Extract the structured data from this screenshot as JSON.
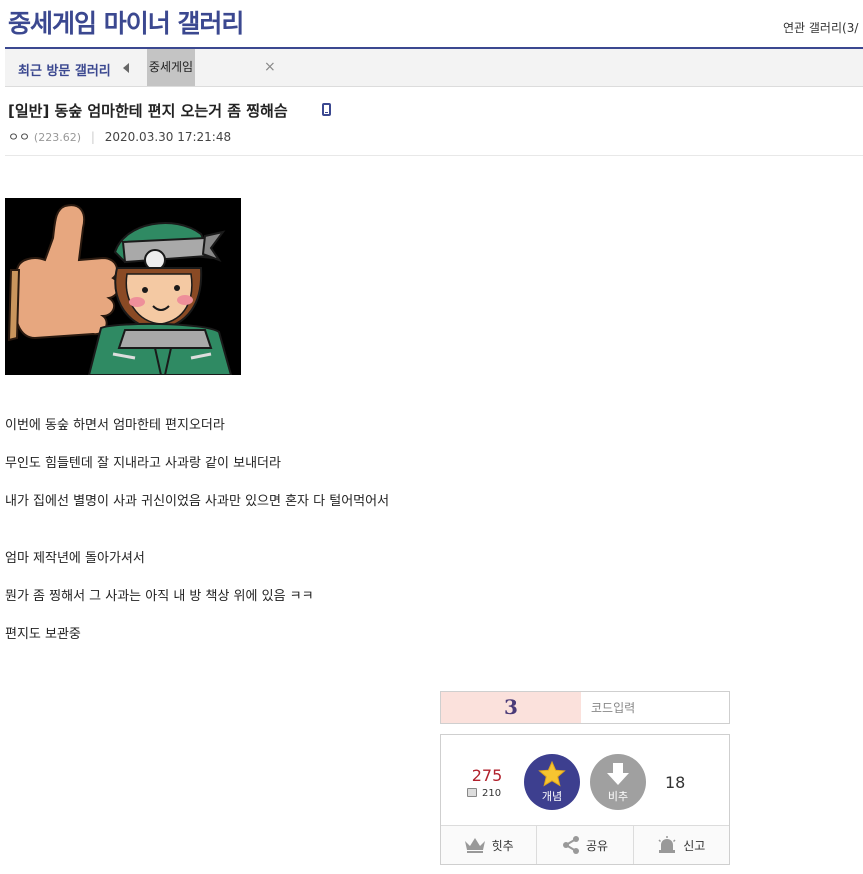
{
  "header": {
    "gallery_title": "중세게임 마이너 갤러리",
    "related_link": "연관 갤러리(3/"
  },
  "recent": {
    "label": "최근 방문 갤러리",
    "items": [
      {
        "label": "중세게임"
      }
    ],
    "close_glyph": "×"
  },
  "post": {
    "title": "[일반] 동숲 엄마한테 편지 오는거 좀 찡해슴",
    "author": "ㅇㅇ",
    "ip": "(223.62)",
    "date": "2020.03.30 17:21:48",
    "image_icon": "villager-thumbs-up-illustration",
    "body": [
      "이번에 동숲 하면서 엄마한테 편지오더라",
      "무인도 힘들텐데 잘 지내라고 사과랑 같이 보내더라",
      "내가 집에선 별명이 사과 귀신이었음 사과만 있으면 혼자 다 털어먹어서",
      "엄마 제작년에 돌아가셔서",
      "뭔가 좀 찡해서 그 사과는 아직 내 방 책상 위에 있음 ㅋㅋ",
      "편지도 보관중"
    ]
  },
  "captcha": {
    "code": "3",
    "placeholder": "코드입력"
  },
  "vote": {
    "recommend_count": "275",
    "fixed_count": "210",
    "recommend_label": "개념",
    "nonrecommend_label": "비추",
    "nonrecommend_count": "18",
    "hit_label": "힛추",
    "share_label": "공유",
    "report_label": "신고"
  },
  "colors": {
    "brand": "#3b4890",
    "recommend_button": "#3d3f8f",
    "nonrecommend_button": "#a0a0a0",
    "recommend_count": "#b1212c",
    "captcha_bg": "#fbe1dc",
    "star": "#f7c531"
  }
}
